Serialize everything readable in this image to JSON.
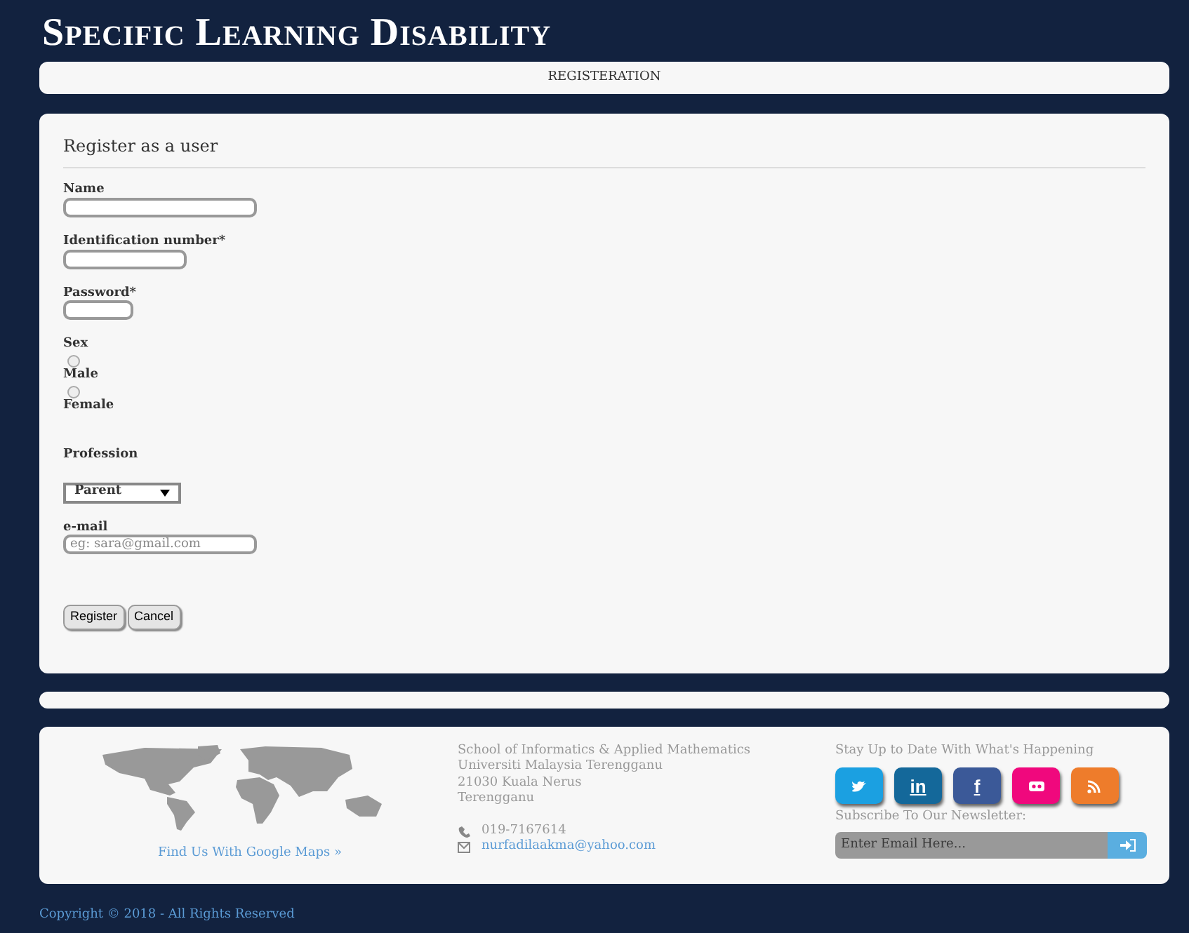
{
  "site_title": "Specific Learning Disability",
  "nav_bar": {
    "label": "REGISTERATION"
  },
  "form": {
    "heading": "Register as a user",
    "fields": [
      {
        "kind": "text",
        "label": "Name"
      },
      {
        "kind": "text",
        "label": "Identification number*"
      },
      {
        "kind": "password",
        "label": "Password*"
      },
      {
        "kind": "radio",
        "label": "Sex",
        "options": [
          {
            "label": "Male",
            "checked": false
          },
          {
            "label": "Female",
            "checked": false
          }
        ]
      },
      {
        "kind": "select",
        "label": "Profession",
        "value": "Parent"
      },
      {
        "kind": "email",
        "label": "e-mail",
        "placeholder": "eg: sara@gmail.com"
      }
    ],
    "buttons": [
      "Register",
      "Cancel"
    ]
  },
  "footer": {
    "map_link": "Find Us With Google Maps »",
    "address": [
      "School of Informatics & Applied Mathematics",
      "Universiti Malaysia Terengganu",
      "21030 Kuala Nerus",
      "Terengganu"
    ],
    "phone": "019-7167614",
    "email": "nurfadilaakma@yahoo.com",
    "social_heading": "Stay Up to Date With What's Happening",
    "social": [
      {
        "kind": "twitter",
        "color": "#1ba0e1"
      },
      {
        "kind": "linkedin",
        "color": "#14689a",
        "label": "in"
      },
      {
        "kind": "facebook",
        "color": "#3b5998",
        "label": "f"
      },
      {
        "kind": "flickr",
        "color": "#f0087d"
      },
      {
        "kind": "rss",
        "color": "#ee7c2b"
      }
    ],
    "newsletter_heading": "Subscribe To Our Newsletter:",
    "newsletter_placeholder": "Enter Email Here..."
  },
  "copyright": "Copyright © 2018 - All Rights Reserved"
}
